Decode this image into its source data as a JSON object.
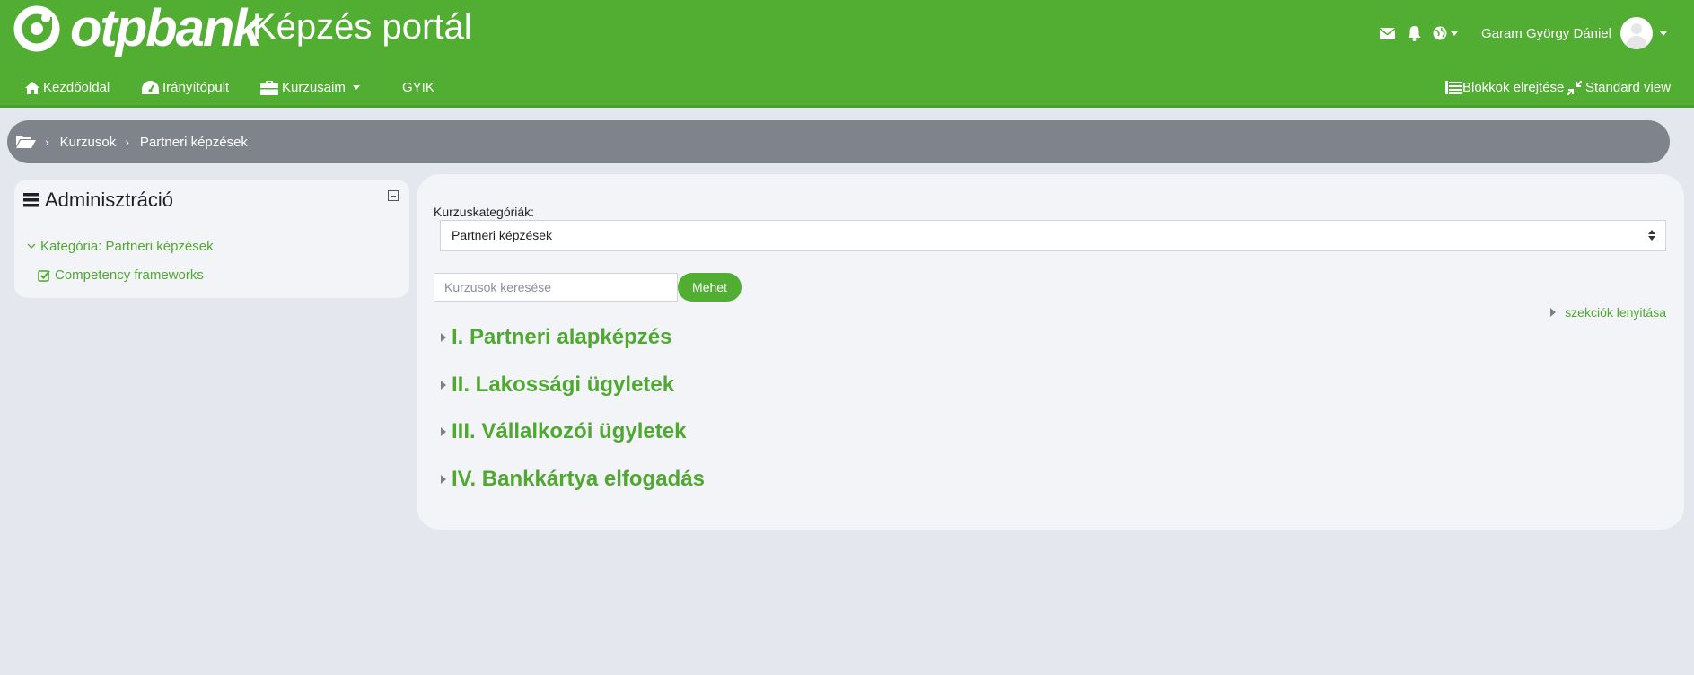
{
  "header": {
    "logo_text": "otpbank",
    "portal_title": "Képzés portál",
    "username": "Garam György Dániel",
    "icons": [
      "envelope-icon",
      "bell-icon",
      "globe-icon"
    ]
  },
  "nav": {
    "items": [
      {
        "label": "Kezdőoldal",
        "icon": "home-icon"
      },
      {
        "label": "Irányítópult",
        "icon": "dashboard-icon"
      },
      {
        "label": "Kurzusaim",
        "icon": "briefcase-icon"
      },
      {
        "label": "GYIK"
      }
    ],
    "right": [
      {
        "label": "Blokkok elrejtése",
        "icon": "list-icon"
      },
      {
        "label": "Standard view",
        "icon": "compress-icon"
      }
    ]
  },
  "breadcrumb": {
    "items": [
      "Kurzusok",
      "Partneri képzések"
    ]
  },
  "admin": {
    "title": "Adminisztráció",
    "category": "Kategória: Partneri képzések",
    "competency": "Competency frameworks"
  },
  "main": {
    "category_label": "Kurzuskategóriák:",
    "category_selected": "Partneri képzések",
    "search_placeholder": "Kurzusok keresése",
    "go_label": "Mehet",
    "expand_all": "szekciók lenyitása",
    "sections": [
      "I. Partneri alapképzés",
      "II. Lakossági ügyletek",
      "III. Vállalkozói ügyletek",
      "IV. Bankkártya elfogadás"
    ]
  },
  "colors": {
    "brand_green": "#52ae32",
    "link_green": "#4fa82f",
    "breadcrumb_bg": "#7e838c",
    "page_bg": "#e4e7ee"
  }
}
